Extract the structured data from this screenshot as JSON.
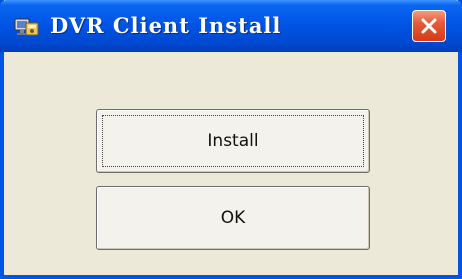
{
  "window": {
    "title": "DVR Client Install",
    "icon": "installer-app-icon",
    "close_icon": "close-icon"
  },
  "buttons": {
    "install_label": "Install",
    "ok_label": "OK"
  },
  "colors": {
    "titlebar": "#0055E5",
    "dialog_bg": "#ECE9D8",
    "close_button": "#E35C3A",
    "button_face": "#F3F2EC"
  }
}
